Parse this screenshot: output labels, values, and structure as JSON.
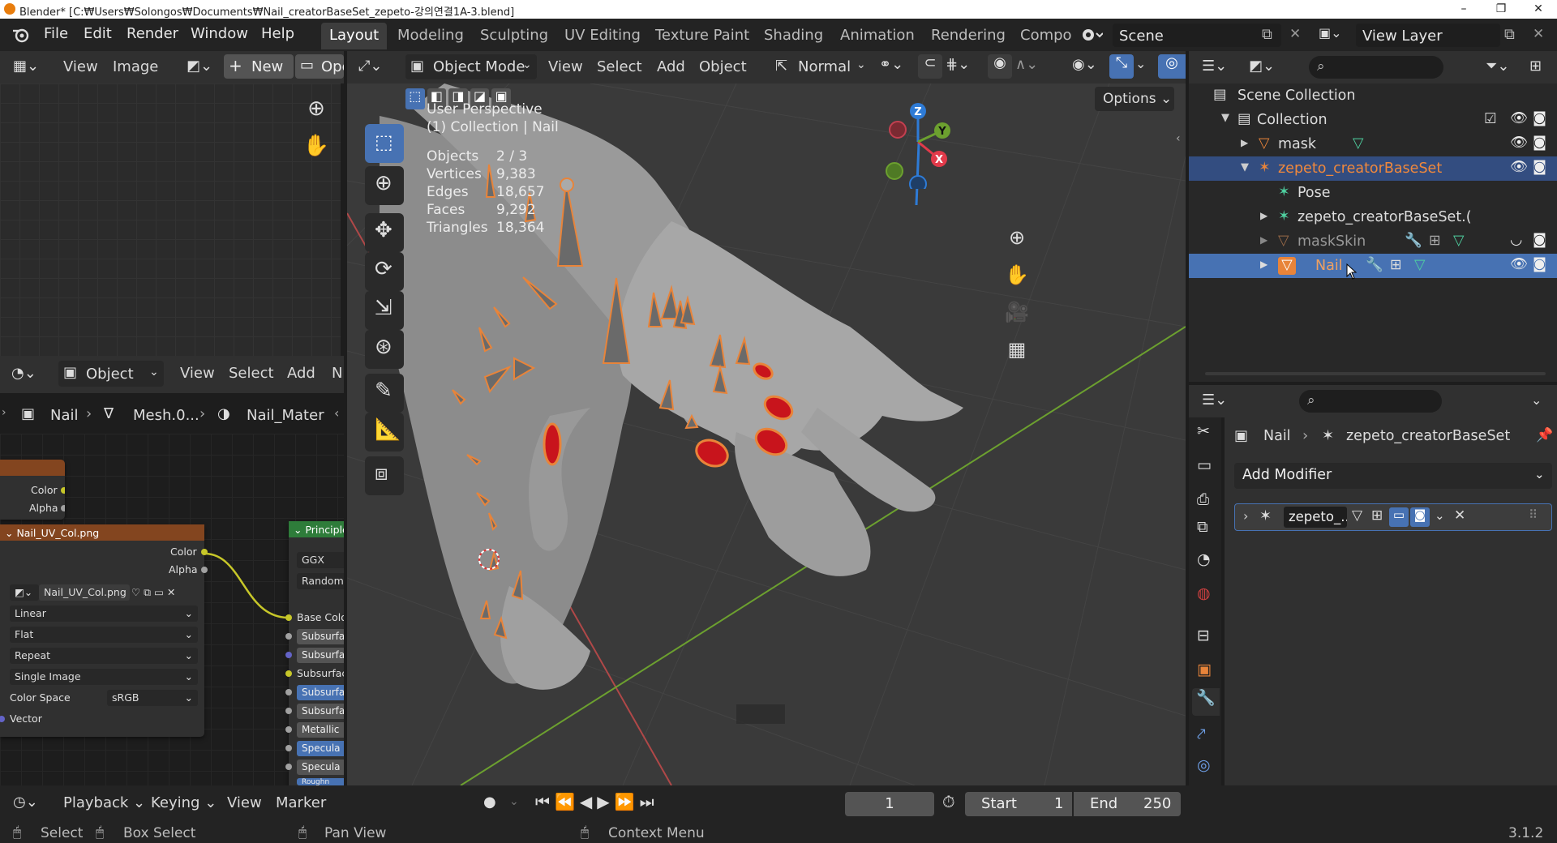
{
  "titlebar": {
    "title": "Blender* [C:₩Users₩Solongos₩Documents₩Nail_creatorBaseSet_zepeto-강의연결1A-3.blend]",
    "minimize": "–",
    "maximize": "❐",
    "close": "✕"
  },
  "menubar": {
    "items": [
      "File",
      "Edit",
      "Render",
      "Window",
      "Help"
    ],
    "workspaces": [
      "Layout",
      "Modeling",
      "Sculpting",
      "UV Editing",
      "Texture Paint",
      "Shading",
      "Animation",
      "Rendering",
      "Compo"
    ],
    "active_workspace": "Layout",
    "scene": "Scene",
    "view_layer": "View Layer"
  },
  "image_editor": {
    "menu": [
      "View",
      "Image"
    ],
    "new_label": "New",
    "open_label": "Ope"
  },
  "node_editor": {
    "header_menu": [
      "View",
      "Select",
      "Add",
      "N"
    ],
    "object_mode": "Object",
    "breadcrumb": [
      "Nail",
      "Mesh.0...",
      "Nail_Mater"
    ],
    "partial_node": {
      "color_label": "Color",
      "alpha_label": "Alpha"
    },
    "image_node": {
      "title": "Nail_UV_Col.png",
      "color_label": "Color",
      "alpha_label": "Alpha",
      "image_name": "Nail_UV_Col.png",
      "interpolation": "Linear",
      "projection": "Flat",
      "extension": "Repeat",
      "source": "Single Image",
      "color_space_label": "Color Space",
      "color_space": "sRGB",
      "vector_label": "Vector"
    },
    "principled_node": {
      "title": "Principle",
      "rows": [
        "GGX",
        "Random",
        "Base Colo",
        "Subsurfa",
        "Subsurfa",
        "Subsurfac",
        "Subsurfa",
        "Subsurfa",
        "Metallic",
        "Specula",
        "Specula",
        "Roughn"
      ]
    }
  },
  "viewport": {
    "mode": "Object Mode",
    "menu": [
      "View",
      "Select",
      "Add",
      "Object"
    ],
    "shading": "Normal",
    "options_label": "Options",
    "perspective": "User Perspective",
    "collection_info": "(1) Collection | Nail",
    "stats": [
      {
        "label": "Objects",
        "value": "2 / 3"
      },
      {
        "label": "Vertices",
        "value": "9,383"
      },
      {
        "label": "Edges",
        "value": "18,657"
      },
      {
        "label": "Faces",
        "value": "9,292"
      },
      {
        "label": "Triangles",
        "value": "18,364"
      }
    ],
    "gizmo": {
      "x": "X",
      "y": "Y",
      "z": "Z"
    }
  },
  "outliner": {
    "rows": [
      {
        "label": "Scene Collection",
        "icon": "scene-collection-icon"
      },
      {
        "label": "Collection",
        "icon": "collection-icon"
      },
      {
        "label": "mask",
        "icon": "mesh-icon"
      },
      {
        "label": "zepeto_creatorBaseSet",
        "icon": "armature-icon"
      },
      {
        "label": "Pose",
        "icon": "pose-icon"
      },
      {
        "label": "zepeto_creatorBaseSet.(",
        "icon": "armature-data-icon"
      },
      {
        "label": "maskSkin",
        "icon": "mesh-icon"
      },
      {
        "label": "Nail",
        "icon": "mesh-icon"
      }
    ]
  },
  "properties": {
    "breadcrumb_object": "Nail",
    "breadcrumb_armature": "zepeto_creatorBaseSet",
    "add_modifier": "Add Modifier",
    "modifier_name": "zepeto_..."
  },
  "timeline": {
    "menu": [
      "Playback",
      "Keying",
      "View",
      "Marker"
    ],
    "current_frame": "1",
    "start_label": "Start",
    "start": "1",
    "end_label": "End",
    "end": "250"
  },
  "statusbar": {
    "select": "Select",
    "box_select": "Box Select",
    "pan_view": "Pan View",
    "context_menu": "Context Menu",
    "version": "3.1.2"
  },
  "colors": {
    "selection_orange": "#e8843a",
    "active_blue": "#4772b3",
    "nail_red": "#c8141c"
  }
}
